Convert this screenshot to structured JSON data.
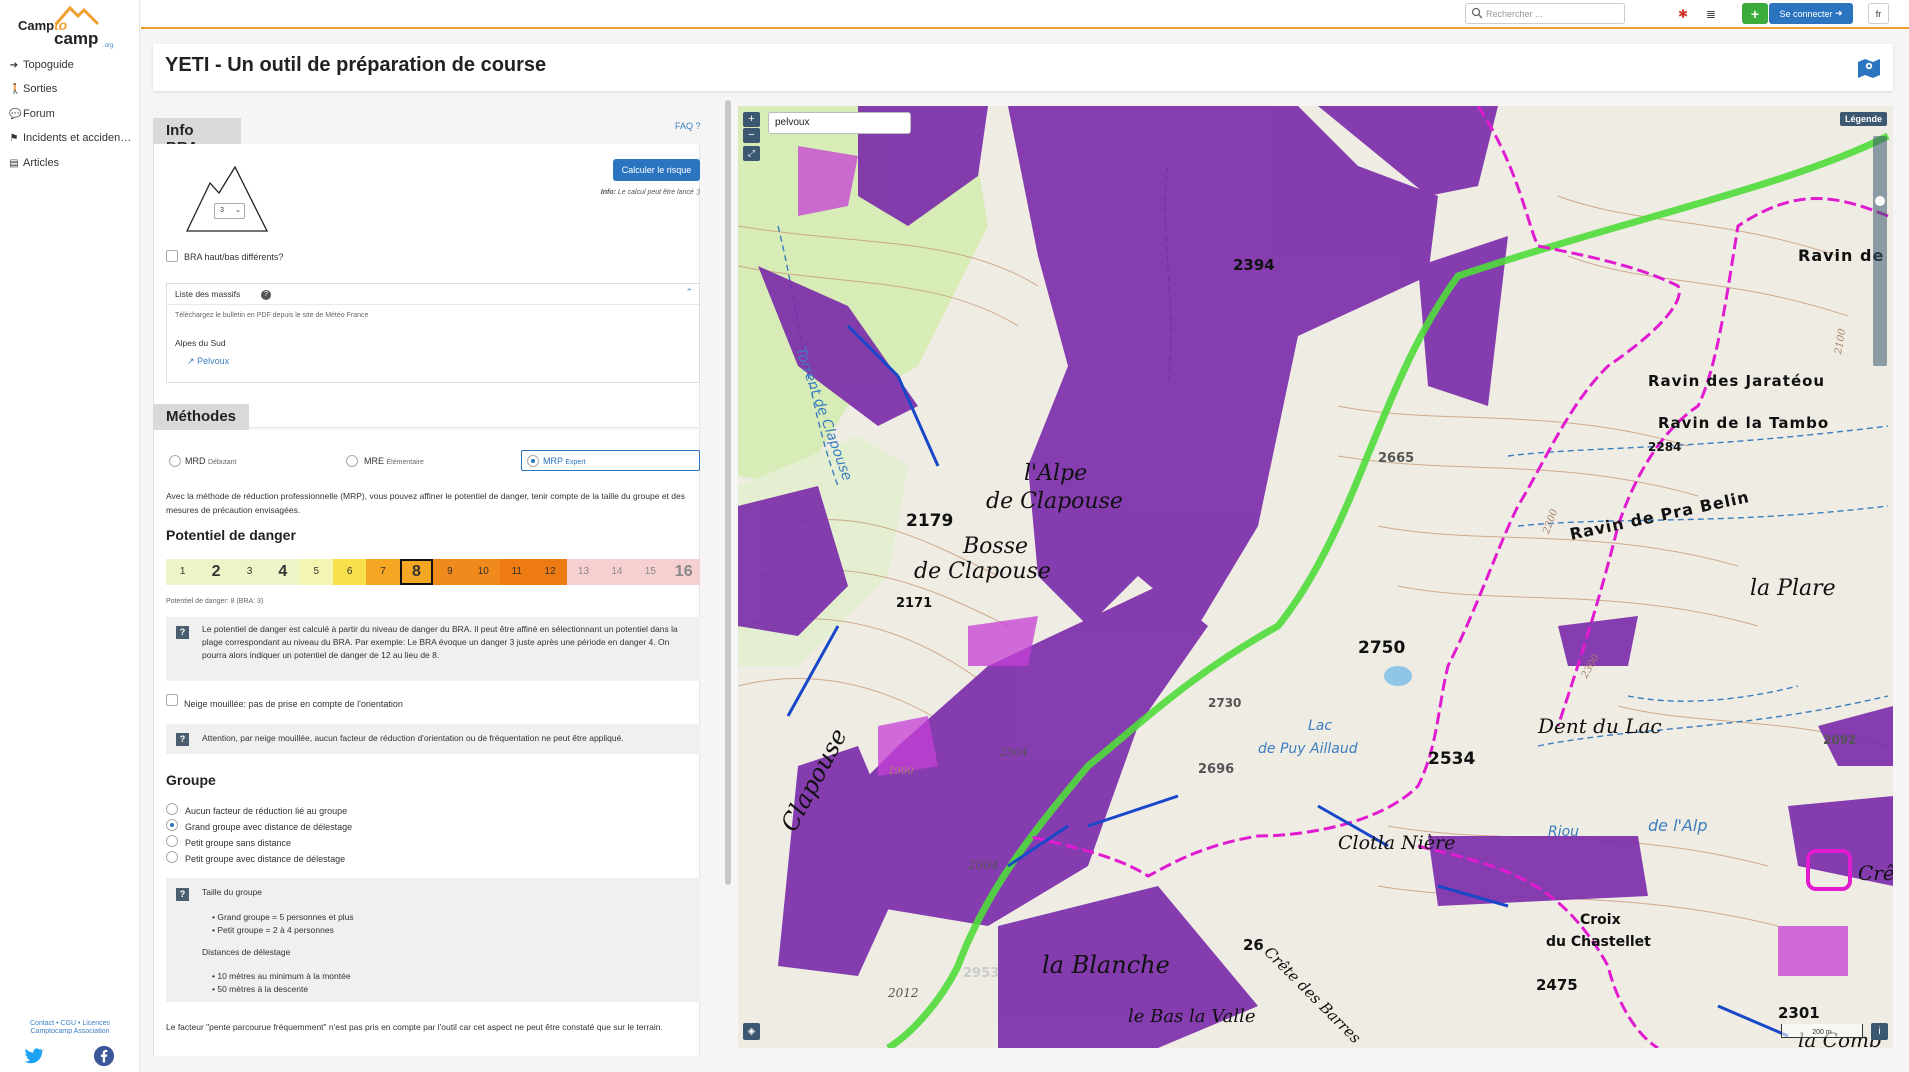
{
  "brand": {
    "logo_text_1": "Camp",
    "logo_text_2": "to",
    "logo_text_3": "camp",
    "logo_suffix": ".org",
    "accent": "#f0a030"
  },
  "sidebar": {
    "items": [
      {
        "label": "Topoguide",
        "icon": "arrow-right-icon"
      },
      {
        "label": "Sorties",
        "icon": "hiker-icon"
      },
      {
        "label": "Forum",
        "icon": "comments-icon"
      },
      {
        "label": "Incidents et acciden…",
        "icon": "flag-icon"
      },
      {
        "label": "Articles",
        "icon": "newspaper-icon"
      }
    ],
    "footer_line1": "Contact • CGU • Licences",
    "footer_line2": "Camptocamp Association"
  },
  "topbar": {
    "search_placeholder": "Rechercher ...",
    "plus_label": "+",
    "login_label": "Se connecter",
    "lang_label": "fr"
  },
  "page": {
    "title": "YETI - Un outil de préparation de course"
  },
  "bra": {
    "header": "Info BRA",
    "faq": "FAQ ?",
    "calc_button": "Calculer le risque",
    "info_prefix": "Info:",
    "info_text": "Le calcul peut être lancé :)",
    "select_value": "3",
    "diff_checkbox": "BRA haut/bas différents?",
    "massifs_title": "Liste des massifs",
    "massifs_download": "Téléchargez le bulletin en PDF depuis le site de Météo France",
    "massif_group": "Alpes du Sud",
    "massif_link": "Pelvoux"
  },
  "methods": {
    "header": "Méthodes",
    "options": [
      {
        "name": "MRD",
        "sub": "Débutant",
        "selected": false
      },
      {
        "name": "MRE",
        "sub": "Élémentaire",
        "selected": false
      },
      {
        "name": "MRP",
        "sub": "Expert",
        "selected": true
      }
    ],
    "description": "Avec la méthode de réduction professionnelle (MRP), vous pouvez affiner le potentiel de danger, tenir compte de la taille du groupe et des mesures de précaution envisagées."
  },
  "danger": {
    "title": "Potentiel de danger",
    "scale": [
      "1",
      "2",
      "3",
      "4",
      "5",
      "6",
      "7",
      "8",
      "9",
      "10",
      "11",
      "12",
      "13",
      "14",
      "15",
      "16"
    ],
    "selected": "8",
    "caption": "Potentiel de danger: 8 (BRA: 3)",
    "help": "Le potentiel de danger est calculé à partir du niveau de danger du BRA. Il peut être affiné en sélectionnant un potentiel dans la plage correspondant au niveau du BRA. Par exemple: Le BRA évoque un danger 3 juste après une période en danger 4. On pourra alors indiquer un potentiel de danger de 12 au lieu de 8."
  },
  "wet_snow": {
    "checkbox": "Neige mouillée: pas de prise en compte de l'orientation",
    "warning": "Attention, par neige mouillée, aucun facteur de réduction d'orientation ou de fréquentation ne peut être appliqué."
  },
  "group": {
    "title": "Groupe",
    "options": [
      {
        "label": "Aucun facteur de réduction lié au groupe",
        "selected": false
      },
      {
        "label": "Grand groupe avec distance de délestage",
        "selected": true
      },
      {
        "label": "Petit groupe sans distance",
        "selected": false
      },
      {
        "label": "Petit groupe avec distance de délestage",
        "selected": false
      }
    ],
    "size_title": "Taille du groupe",
    "size_items": [
      "Grand groupe = 5 personnes et plus",
      "Petit groupe = 2 à 4 personnes"
    ],
    "dist_title": "Distances de délestage",
    "dist_items": [
      "10 mètres au minimum à la montée",
      "50 mètres à la descente"
    ],
    "footer_note": "Le facteur \"pente parcourue fréquemment\" n'est pas pris en compte par l'outil car cet aspect ne peut être constaté que sur le terrain."
  },
  "map": {
    "search_value": "pelvoux",
    "legend_btn": "Légende",
    "scale_label": "200 m",
    "zoom_in": "+",
    "zoom_out": "−",
    "info_btn": "i",
    "places": [
      "2394",
      "Ravin de",
      "Ravin des Jaratéou",
      "Ravin de la Tambo",
      "2284",
      "2100",
      "2665",
      "l'Alpe",
      "de Clapouse",
      "2179",
      "Bosse",
      "de Clapouse",
      "2171",
      "Ravin de Pra Belin",
      "la Plare",
      "2750",
      "Dent du Lac",
      "2534",
      "Lac",
      "de Puy Aillaud",
      "2696",
      "Clapouse",
      "Riou",
      "de l'Alp",
      "Clotla Nière",
      "Croix",
      "du Chastellet",
      "2475",
      "2953",
      "la Blanche",
      "Crête des Barres",
      "le Bas la Valle",
      "2730",
      "2092",
      "Crêt",
      "la Comb",
      "2301",
      "2300",
      "2200",
      "Torrent de Clapouse",
      "1900",
      "2004",
      "2012",
      "2504",
      "26"
    ]
  }
}
